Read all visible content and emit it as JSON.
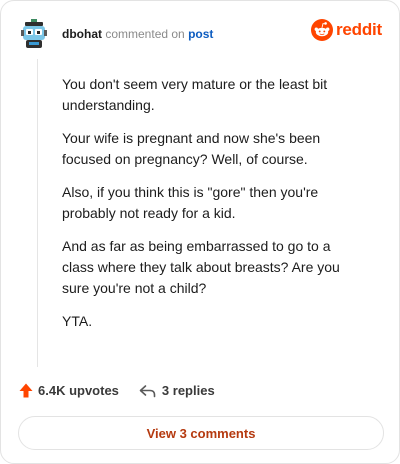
{
  "header": {
    "author": "dbohat",
    "commented_on": "commented on",
    "post_link": "post"
  },
  "brand": {
    "wordmark": "reddit",
    "icon": "reddit-snoo-icon",
    "color": "#ff4500"
  },
  "comment": {
    "paragraphs": [
      "You don't seem very mature or the least bit understanding.",
      "Your wife is pregnant and now she's been focused on pregnancy? Well, of course.",
      "Also, if you think this is \"gore\" then you're probably not ready for a kid.",
      "And as far as being embarrassed to go to a class where they talk about breasts? Are you sure you're not a child?",
      "YTA."
    ]
  },
  "actions": {
    "upvotes_label": "6.4K upvotes",
    "upvote_icon": "upvote-arrow-icon",
    "replies_label": "3 replies",
    "reply_icon": "reply-arrow-icon",
    "upvote_color": "#ff4500"
  },
  "footer": {
    "view_comments_label": "View 3 comments"
  }
}
